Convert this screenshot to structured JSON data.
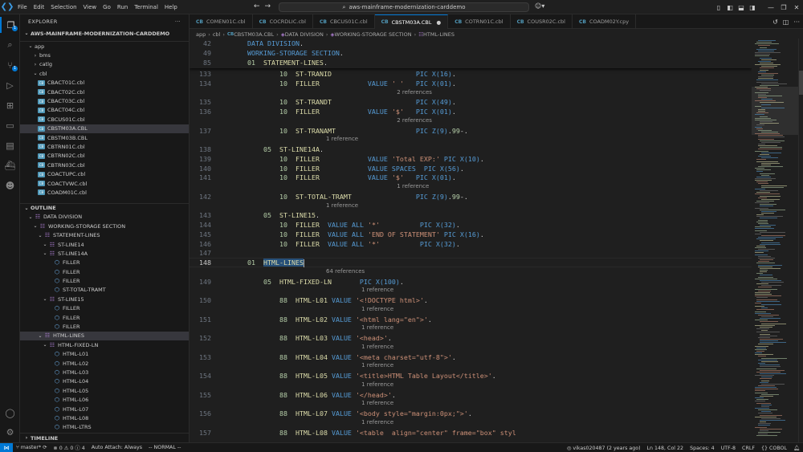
{
  "menu": [
    "File",
    "Edit",
    "Selection",
    "View",
    "Go",
    "Run",
    "Terminal",
    "Help"
  ],
  "search": {
    "text": "aws-mainframe-modernization-carddemo"
  },
  "explorer": {
    "title": "EXPLORER",
    "workspace": "AWS-MAINFRAME-MODERNIZATION-CARDDEMO",
    "app_folder": "app",
    "folders": [
      "bms",
      "catlg"
    ],
    "cbl_folder": "cbl",
    "files": [
      "CBACT01C.cbl",
      "CBACT02C.cbl",
      "CBACT03C.cbl",
      "CBACT04C.cbl",
      "CBCUS01C.cbl",
      "CBSTM03A.CBL",
      "CBSTM03B.CBL",
      "CBTRN01C.cbl",
      "CBTRN02C.cbl",
      "CBTRN03C.cbl",
      "COACTUPC.cbl",
      "COACTVWC.cbl",
      "COADM01C.cbl"
    ],
    "selected_file": "CBSTM03A.CBL"
  },
  "outline": {
    "title": "OUTLINE",
    "rows": [
      {
        "label": "DATA DIVISION",
        "indent": 1,
        "chev": "open",
        "icon": "struct"
      },
      {
        "label": "WORKING-STORAGE SECTION",
        "indent": 2,
        "chev": "open",
        "icon": "struct"
      },
      {
        "label": "STATEMENT-LINES",
        "indent": 3,
        "chev": "open",
        "icon": "struct"
      },
      {
        "label": "ST-LINE14",
        "indent": 4,
        "chev": "open",
        "icon": "struct"
      },
      {
        "label": "ST-LINE14A",
        "indent": 4,
        "chev": "open",
        "icon": "struct"
      },
      {
        "label": "FILLER",
        "indent": 5,
        "chev": "none",
        "icon": "field"
      },
      {
        "label": "FILLER",
        "indent": 5,
        "chev": "none",
        "icon": "field"
      },
      {
        "label": "FILLER",
        "indent": 5,
        "chev": "none",
        "icon": "field"
      },
      {
        "label": "ST-TOTAL-TRAMT",
        "indent": 5,
        "chev": "none",
        "icon": "field"
      },
      {
        "label": "ST-LINE15",
        "indent": 4,
        "chev": "open",
        "icon": "struct"
      },
      {
        "label": "FILLER",
        "indent": 5,
        "chev": "none",
        "icon": "field"
      },
      {
        "label": "FILLER",
        "indent": 5,
        "chev": "none",
        "icon": "field"
      },
      {
        "label": "FILLER",
        "indent": 5,
        "chev": "none",
        "icon": "field"
      },
      {
        "label": "HTML-LINES",
        "indent": 3,
        "chev": "open",
        "icon": "struct",
        "selected": true
      },
      {
        "label": "HTML-FIXED-LN",
        "indent": 4,
        "chev": "open",
        "icon": "struct"
      },
      {
        "label": "HTML-L01",
        "indent": 5,
        "chev": "none",
        "icon": "field"
      },
      {
        "label": "HTML-L02",
        "indent": 5,
        "chev": "none",
        "icon": "field"
      },
      {
        "label": "HTML-L03",
        "indent": 5,
        "chev": "none",
        "icon": "field"
      },
      {
        "label": "HTML-L04",
        "indent": 5,
        "chev": "none",
        "icon": "field"
      },
      {
        "label": "HTML-L05",
        "indent": 5,
        "chev": "none",
        "icon": "field"
      },
      {
        "label": "HTML-L06",
        "indent": 5,
        "chev": "none",
        "icon": "field"
      },
      {
        "label": "HTML-L07",
        "indent": 5,
        "chev": "none",
        "icon": "field"
      },
      {
        "label": "HTML-L08",
        "indent": 5,
        "chev": "none",
        "icon": "field"
      },
      {
        "label": "HTML-LTRS",
        "indent": 5,
        "chev": "none",
        "icon": "field"
      }
    ]
  },
  "timeline": {
    "title": "TIMELINE"
  },
  "tabs": [
    {
      "label": "COMEN01C.cbl"
    },
    {
      "label": "COCRDLIC.cbl"
    },
    {
      "label": "CBCUS01C.cbl"
    },
    {
      "label": "CBSTM03A.CBL",
      "active": true,
      "dirty": true
    },
    {
      "label": "COTRN01C.cbl"
    },
    {
      "label": "COUSR02C.cbl"
    },
    {
      "label": "COADM02Y.cpy"
    }
  ],
  "breadcrumb": [
    "app",
    "cbl",
    "CBSTM03A.CBL",
    "DATA DIVISION",
    "WORKING-STORAGE SECTION",
    "HTML-LINES"
  ],
  "editor": {
    "sticky": [
      {
        "ln": "42",
        "code": "DATA DIVISION."
      },
      {
        "ln": "49",
        "code": "WORKING-STORAGE SECTION."
      },
      {
        "ln": "85",
        "code": "01  STATEMENT-LINES."
      }
    ],
    "lines": [
      {
        "ln": "133",
        "code": "    10  ST-TRANID                     PIC X(16)."
      },
      {
        "ln": "134",
        "code": "    10  FILLER            VALUE ' '   PIC X(01)."
      },
      {
        "lens": "2 references",
        "indent": 38
      },
      {
        "ln": "135",
        "code": "    10  ST-TRANDT                     PIC X(49)."
      },
      {
        "ln": "136",
        "code": "    10  FILLER            VALUE '$'   PIC X(01)."
      },
      {
        "lens": "2 references",
        "indent": 38
      },
      {
        "ln": "137",
        "code": "    10  ST-TRANAMT                    PIC Z(9).99-."
      },
      {
        "lens": "1 reference",
        "indent": 20
      },
      {
        "ln": "138",
        "code": "05  ST-LINE14A."
      },
      {
        "ln": "139",
        "code": "    10  FILLER            VALUE 'Total EXP:' PIC X(10)."
      },
      {
        "ln": "140",
        "code": "    10  FILLER            VALUE SPACES  PIC X(56)."
      },
      {
        "ln": "141",
        "code": "    10  FILLER            VALUE '$'   PIC X(01)."
      },
      {
        "lens": "1 reference",
        "indent": 38
      },
      {
        "ln": "142",
        "code": "    10  ST-TOTAL-TRAMT                PIC Z(9).99-."
      },
      {
        "lens": "1 reference",
        "indent": 20
      },
      {
        "ln": "143",
        "code": "05  ST-LINE15."
      },
      {
        "ln": "144",
        "code": "    10  FILLER  VALUE ALL '*'          PIC X(32)."
      },
      {
        "ln": "145",
        "code": "    10  FILLER  VALUE ALL 'END OF STATEMENT' PIC X(16)."
      },
      {
        "ln": "146",
        "code": "    10  FILLER  VALUE ALL '*'          PIC X(32)."
      },
      {
        "ln": "147",
        "code": ""
      },
      {
        "ln": "148",
        "code": "HTML-LINES",
        "current": true
      },
      {
        "lens": "64 references",
        "indent": 20
      },
      {
        "ln": "149",
        "code": "05  HTML-FIXED-LN       PIC X(100)."
      },
      {
        "lens": "1 reference",
        "indent": 29
      },
      {
        "ln": "150",
        "code": "    88  HTML-L01 VALUE '<!DOCTYPE html>'."
      },
      {
        "lens": "1 reference",
        "indent": 29
      },
      {
        "ln": "151",
        "code": "    88  HTML-L02 VALUE '<html lang=\"en\">'."
      },
      {
        "lens": "1 reference",
        "indent": 29
      },
      {
        "ln": "152",
        "code": "    88  HTML-L03 VALUE '<head>'."
      },
      {
        "lens": "1 reference",
        "indent": 29
      },
      {
        "ln": "153",
        "code": "    88  HTML-L04 VALUE '<meta charset=\"utf-8\">'."
      },
      {
        "lens": "1 reference",
        "indent": 29
      },
      {
        "ln": "154",
        "code": "    88  HTML-L05 VALUE '<title>HTML Table Layout</title>'."
      },
      {
        "lens": "1 reference",
        "indent": 29
      },
      {
        "ln": "155",
        "code": "    88  HTML-L06 VALUE '</head>'."
      },
      {
        "lens": "1 reference",
        "indent": 29
      },
      {
        "ln": "156",
        "code": "    88  HTML-L07 VALUE '<body style=\"margin:0px;\">'."
      },
      {
        "lens": "1 reference",
        "indent": 29
      },
      {
        "ln": "157",
        "code": "    88  HTML-L08 VALUE '<table  align=\"center\" frame=\"box\" styl"
      }
    ]
  },
  "statusbar": {
    "branch": "master*",
    "problems": "0",
    "warnings": "0",
    "info": "4",
    "auto_attach": "Auto Attach: Always",
    "vim_mode": "-- NORMAL --",
    "blame": "vikas020487 (2 years ago)",
    "position": "Ln 148, Col 22",
    "spaces": "Spaces: 4",
    "encoding": "UTF-8",
    "eol": "CRLF",
    "language": "COBOL"
  },
  "colors": {
    "accent": "#0078d4",
    "keyword": "#569cd6",
    "number": "#b5cea8",
    "identifier": "#dcdcaa",
    "string": "#ce9178"
  }
}
